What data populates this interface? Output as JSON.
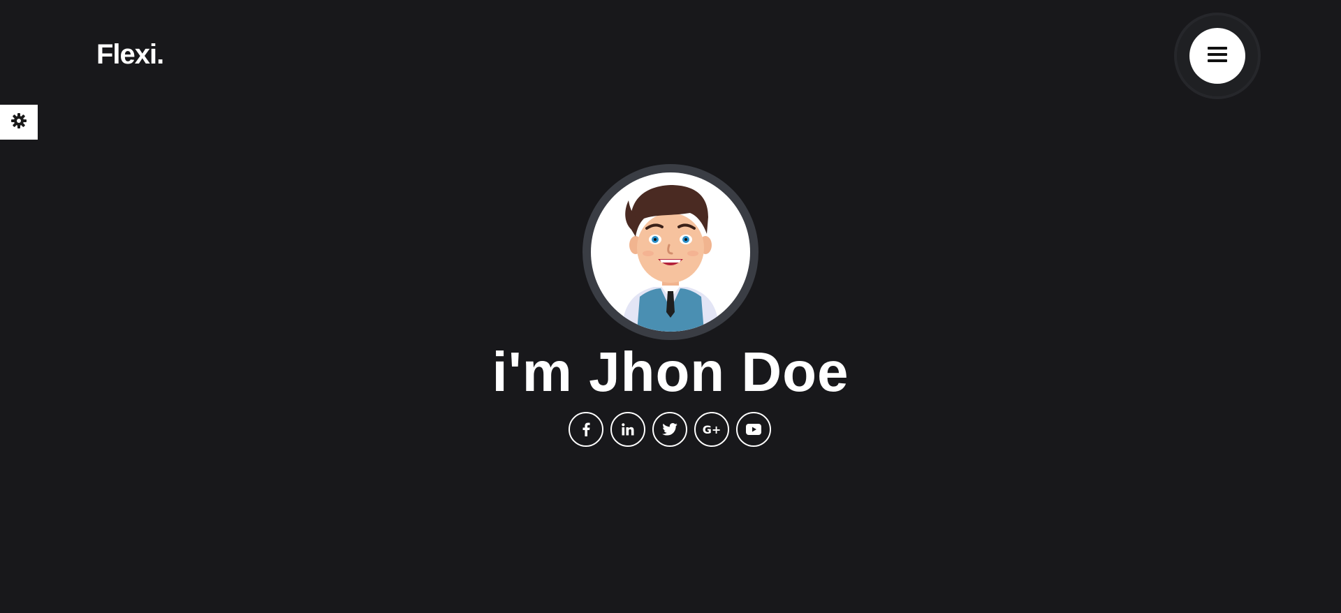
{
  "brand": {
    "logo_text": "Flexi."
  },
  "header": {
    "menu_icon": "hamburger-icon"
  },
  "settings": {
    "icon": "gear-icon"
  },
  "hero": {
    "title": "i'm Jhon Doe",
    "avatar": "cartoon-man-avatar"
  },
  "socials": [
    {
      "name": "facebook",
      "icon": "facebook-icon"
    },
    {
      "name": "linkedin",
      "icon": "linkedin-icon"
    },
    {
      "name": "twitter",
      "icon": "twitter-icon"
    },
    {
      "name": "google-plus",
      "icon": "google-plus-icon",
      "glyph": "G+"
    },
    {
      "name": "youtube",
      "icon": "youtube-icon"
    }
  ],
  "colors": {
    "background": "#18181b",
    "text": "#ffffff",
    "avatar_ring": "#3a3d44"
  }
}
